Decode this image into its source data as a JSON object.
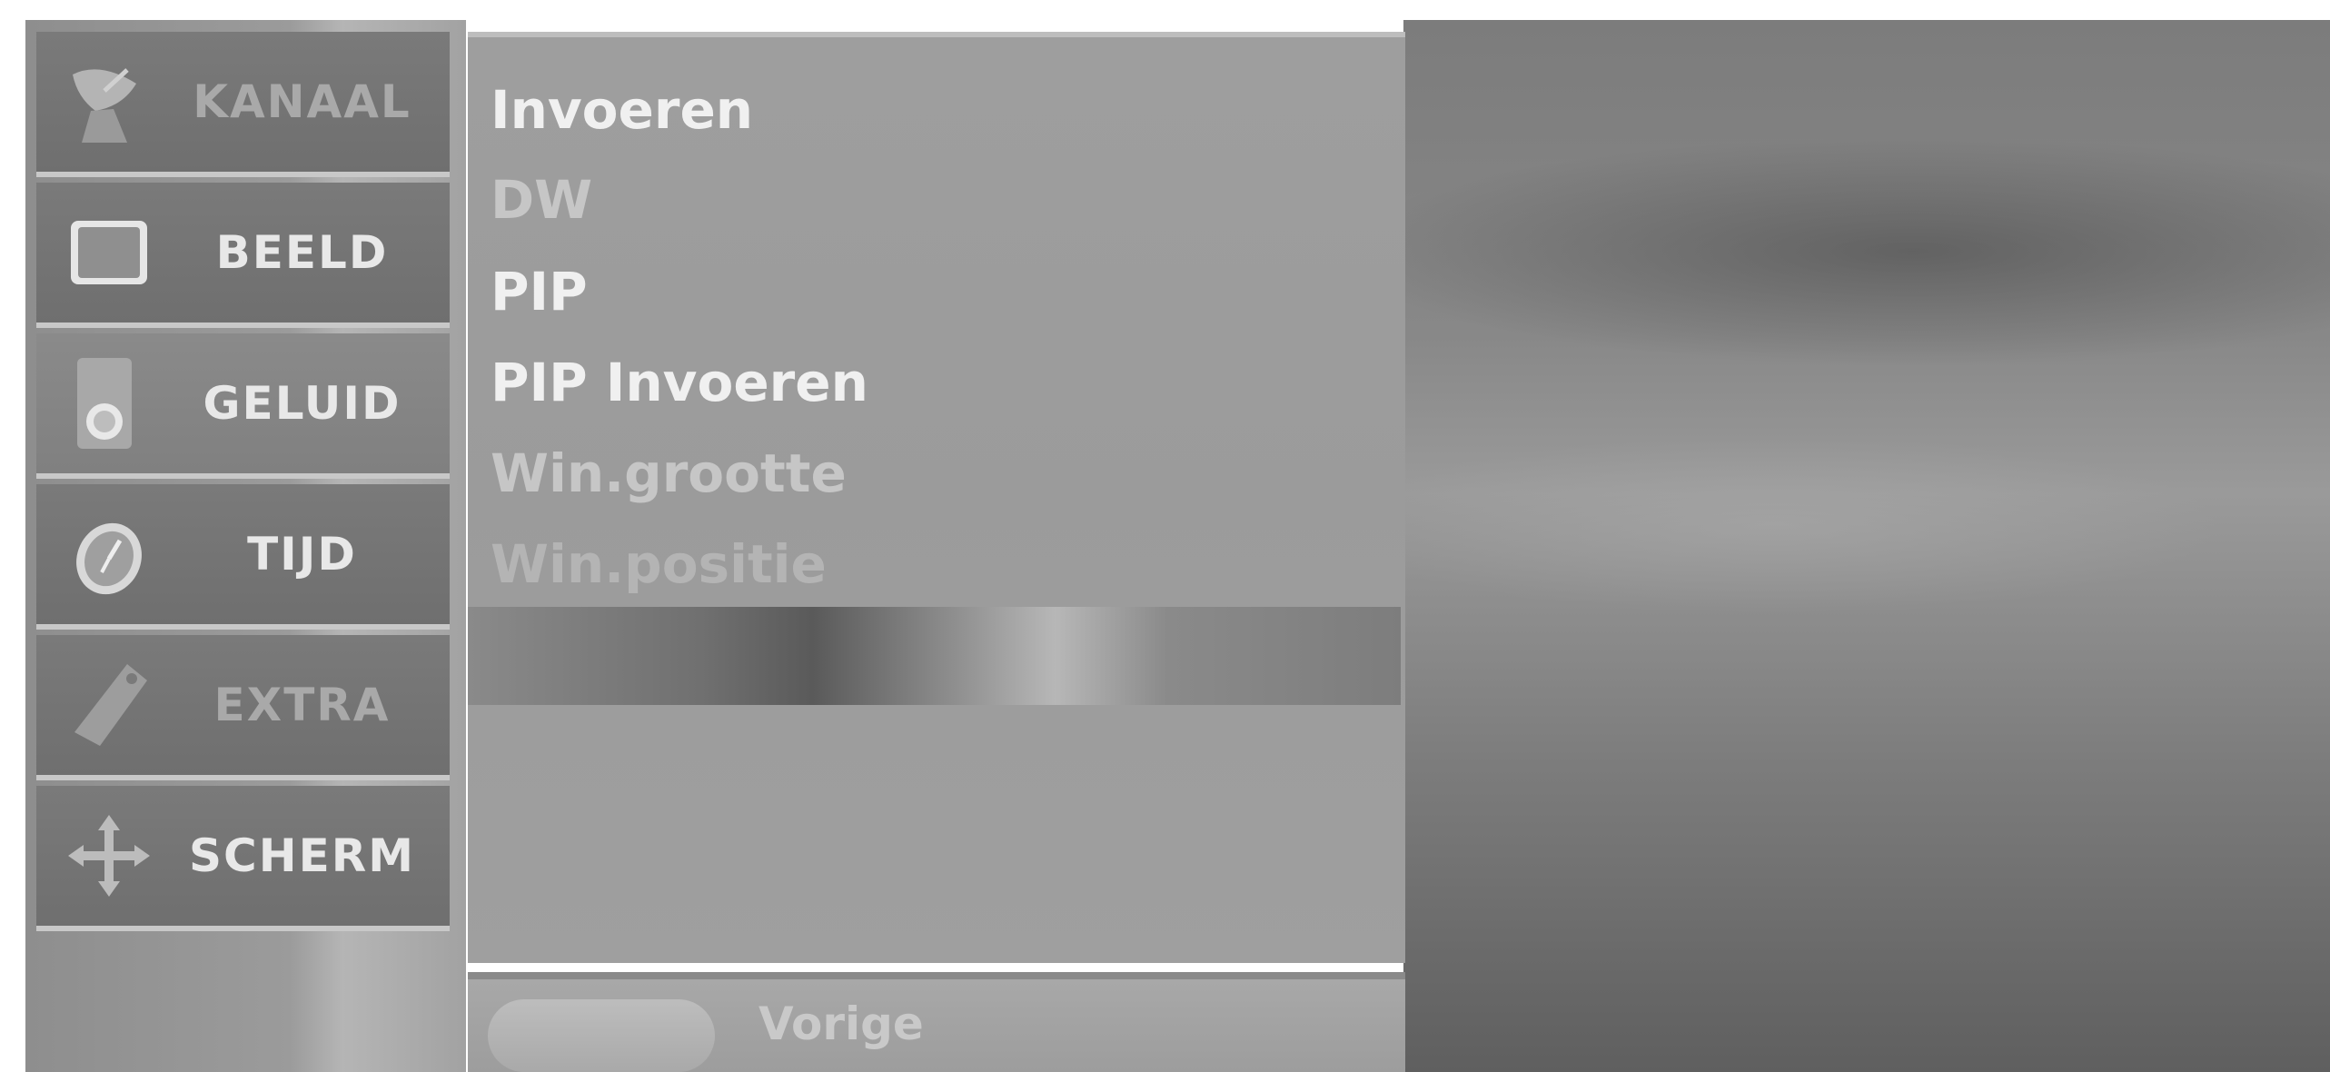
{
  "nav": {
    "items": [
      {
        "label": "KANAAL",
        "icon": "satellite-dish-icon"
      },
      {
        "label": "BEELD",
        "icon": "tv-screen-icon"
      },
      {
        "label": "GELUID",
        "icon": "speaker-icon"
      },
      {
        "label": "TIJD",
        "icon": "clock-icon"
      },
      {
        "label": "EXTRA",
        "icon": "tag-icon"
      },
      {
        "label": "SCHERM",
        "icon": "move-arrows-icon"
      }
    ],
    "selected": "GELUID"
  },
  "menu": {
    "items": [
      {
        "label": "Invoeren"
      },
      {
        "label": "DW"
      },
      {
        "label": "PIP"
      },
      {
        "label": "PIP Invoeren"
      },
      {
        "label": "Win.grootte"
      },
      {
        "label": "Win.positie"
      }
    ]
  },
  "footer": {
    "back_label": "Vorige"
  }
}
